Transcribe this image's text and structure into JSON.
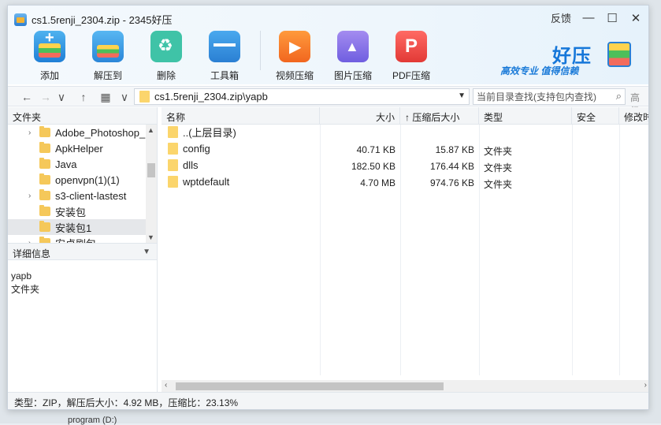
{
  "window": {
    "title": "cs1.5renji_2304.zip - 2345好压",
    "feedback": "反馈",
    "min": "—",
    "max": "☐",
    "close": "✕"
  },
  "toolbar": {
    "add": "添加",
    "extract": "解压到",
    "delete": "删除",
    "toolbox": "工具箱",
    "video": "视频压缩",
    "image": "图片压缩",
    "pdf": "PDF压缩"
  },
  "brand": {
    "name": "好压",
    "slogan": "高效专业  值得信赖"
  },
  "address": {
    "path": "cs1.5renji_2304.zip\\yapb",
    "search_placeholder": "当前目录查找(支持包内查找)",
    "advanced": "高级"
  },
  "left": {
    "header": "文件夹",
    "tree": [
      {
        "label": "Adobe_Photoshop_",
        "expand": "›"
      },
      {
        "label": "ApkHelper",
        "expand": ""
      },
      {
        "label": "Java",
        "expand": ""
      },
      {
        "label": "openvpn(1)(1)",
        "expand": ""
      },
      {
        "label": "s3-client-lastest",
        "expand": "›"
      },
      {
        "label": "安装包",
        "expand": ""
      },
      {
        "label": "安装包1",
        "expand": ""
      },
      {
        "label": "安卓刷包",
        "expand": "›"
      }
    ],
    "detail_header": "详细信息",
    "detail_name": "yapb",
    "detail_type": "文件夹"
  },
  "columns": {
    "name": "名称",
    "size": "大小",
    "csize": "↑ 压缩后大小",
    "type": "类型",
    "security": "安全",
    "modified": "修改时"
  },
  "files": [
    {
      "name": "..(上层目录)",
      "size": "",
      "csize": "",
      "type": ""
    },
    {
      "name": "config",
      "size": "40.71 KB",
      "csize": "15.87 KB",
      "type": "文件夹"
    },
    {
      "name": "dlls",
      "size": "182.50 KB",
      "csize": "176.44 KB",
      "type": "文件夹"
    },
    {
      "name": "wptdefault",
      "size": "4.70 MB",
      "csize": "974.76 KB",
      "type": "文件夹"
    }
  ],
  "status": "类型：ZIP，解压后大小：4.92 MB，压缩比：23.13%",
  "background_text": "program (D:)"
}
